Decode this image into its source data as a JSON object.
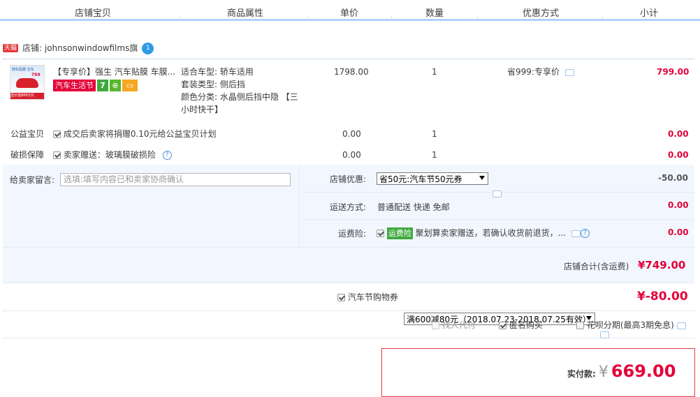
{
  "header": {
    "col_item": "店铺宝贝",
    "col_attr": "商品属性",
    "col_price": "单价",
    "col_qty": "数量",
    "col_discount": "优惠方式",
    "col_subtotal": "小计"
  },
  "shop": {
    "badge": "天猫",
    "label": "店铺: johnsonwindowfilms旗",
    "qq_icon_text": "1"
  },
  "product": {
    "thumb_top_text": "随车贴膜 全车",
    "thumb_price": "799",
    "thumb_bottom_text": "送价值888元礼",
    "title": "【专享价】强生 汽车贴膜 车膜...",
    "tag_festival": "汽车生活节",
    "tag_7": "7",
    "attributes": [
      {
        "label": "适合车型:",
        "value": "轿车适用"
      },
      {
        "label": "套装类型:",
        "value": "侧后挡"
      },
      {
        "label": "颜色分类:",
        "value": "水晶侧后挡中隐 【三"
      },
      {
        "label": "",
        "value": "小时快干】"
      }
    ],
    "price": "1798.00",
    "qty": "1",
    "discount": "省999:专享价",
    "subtotal": "799.00"
  },
  "service_rows": [
    {
      "label": "公益宝贝",
      "text": "成交后卖家将捐赠0.10元给公益宝贝计划",
      "price": "0.00",
      "qty": "1",
      "subtotal": "0.00"
    },
    {
      "label": "破损保障",
      "text": "卖家赠送：玻璃膜破损险",
      "price": "0.00",
      "qty": "1",
      "subtotal": "0.00"
    }
  ],
  "message": {
    "label": "给卖家留言:",
    "placeholder": "选填:填写内容已和卖家协商确认"
  },
  "shop_discount": {
    "label": "店铺优惠:",
    "selected": "省50元:汽车节50元券",
    "amount": "-50.00"
  },
  "shipping": {
    "label": "运送方式:",
    "value": "普通配送 快递 免邮",
    "amount": "0.00"
  },
  "insurance": {
    "label": "运费险:",
    "tag": "运费险",
    "text": "聚划算卖家赠送，若确认收货前退货，...",
    "amount": "0.00"
  },
  "shop_total": {
    "label": "店铺合计(含运费)",
    "amount": "¥749.00"
  },
  "coupon": {
    "label": "汽车节购物券",
    "selected": "满600减80元（2018.07.23-2018.07.25有效）",
    "amount": "¥-80.00"
  },
  "options": {
    "proxy_pay": "找人代付",
    "anonymous": "匿名购买",
    "installment": "花呗分期(最高3期免息)"
  },
  "final": {
    "label": "实付款:",
    "currency": "¥",
    "amount": "669.00"
  },
  "colors": {
    "accent_red": "#e4003a",
    "header_border": "#b2d1ff",
    "panel_blue": "#f2f7ff",
    "final_border": "#e4393c"
  }
}
